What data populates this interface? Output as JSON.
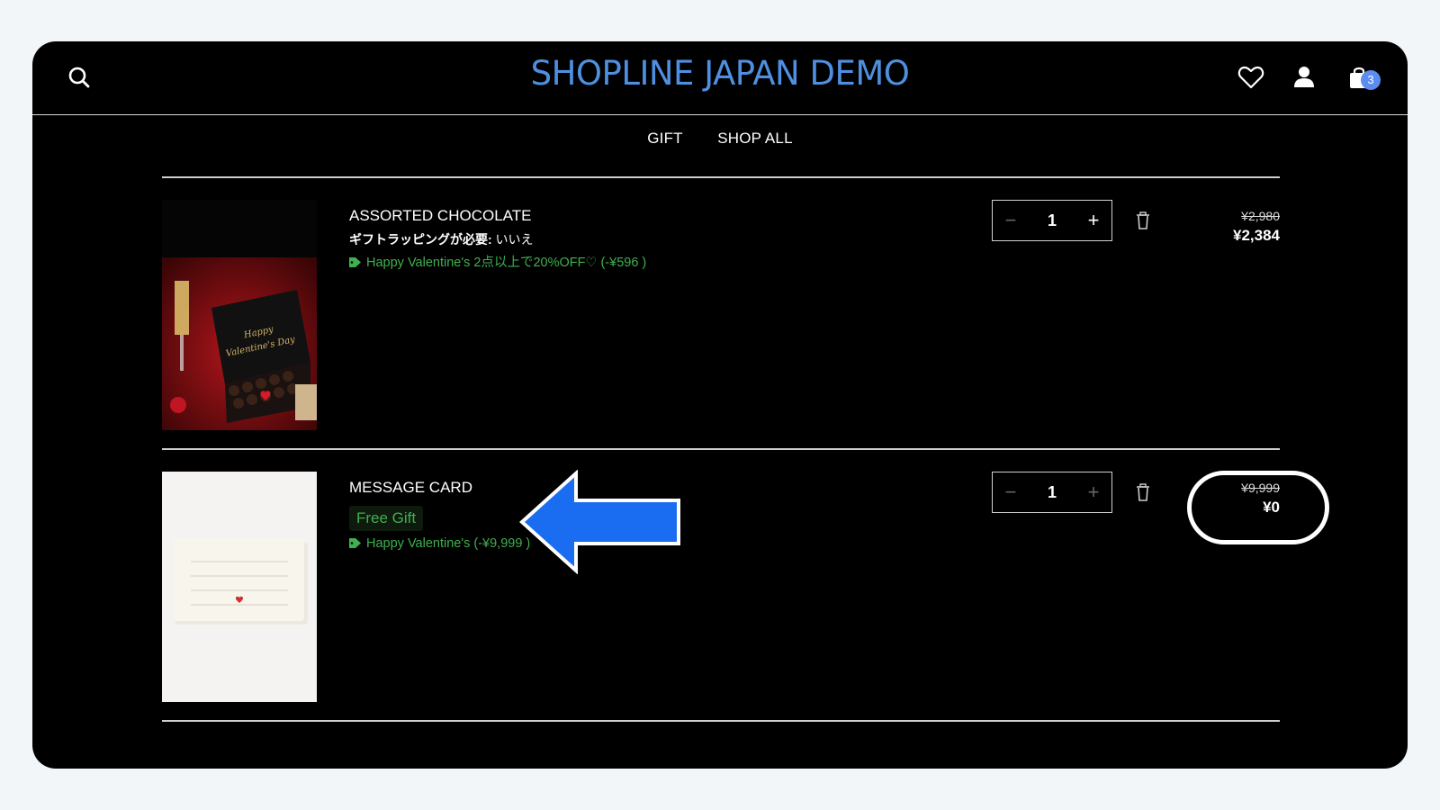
{
  "header": {
    "logo": "SHOPLINE JAPAN DEMO",
    "cart_count": "3",
    "icons": [
      "search-icon",
      "heart-icon",
      "user-icon",
      "bag-icon"
    ]
  },
  "nav": {
    "items": [
      {
        "label": "GIFT"
      },
      {
        "label": "SHOP ALL"
      }
    ]
  },
  "cart": {
    "items": [
      {
        "title": "ASSORTED CHOCOLATE",
        "option_label": "ギフトラッピングが必要:",
        "option_value": " いいえ",
        "promo": "Happy Valentine's 2点以上で20%OFF♡ (-¥596 )",
        "quantity": "1",
        "original_price": "¥2,980",
        "price": "¥2,384"
      },
      {
        "title": "MESSAGE CARD",
        "badge": "Free Gift",
        "promo": "Happy Valentine's (-¥9,999 )",
        "quantity": "1",
        "original_price": "¥9,999",
        "price": "¥0"
      }
    ]
  },
  "colors": {
    "logo": "#4f8fe0",
    "promo_green": "#3fb04f",
    "annotation_arrow": "#1a6cf0",
    "cart_badge": "#5c8cf0"
  }
}
